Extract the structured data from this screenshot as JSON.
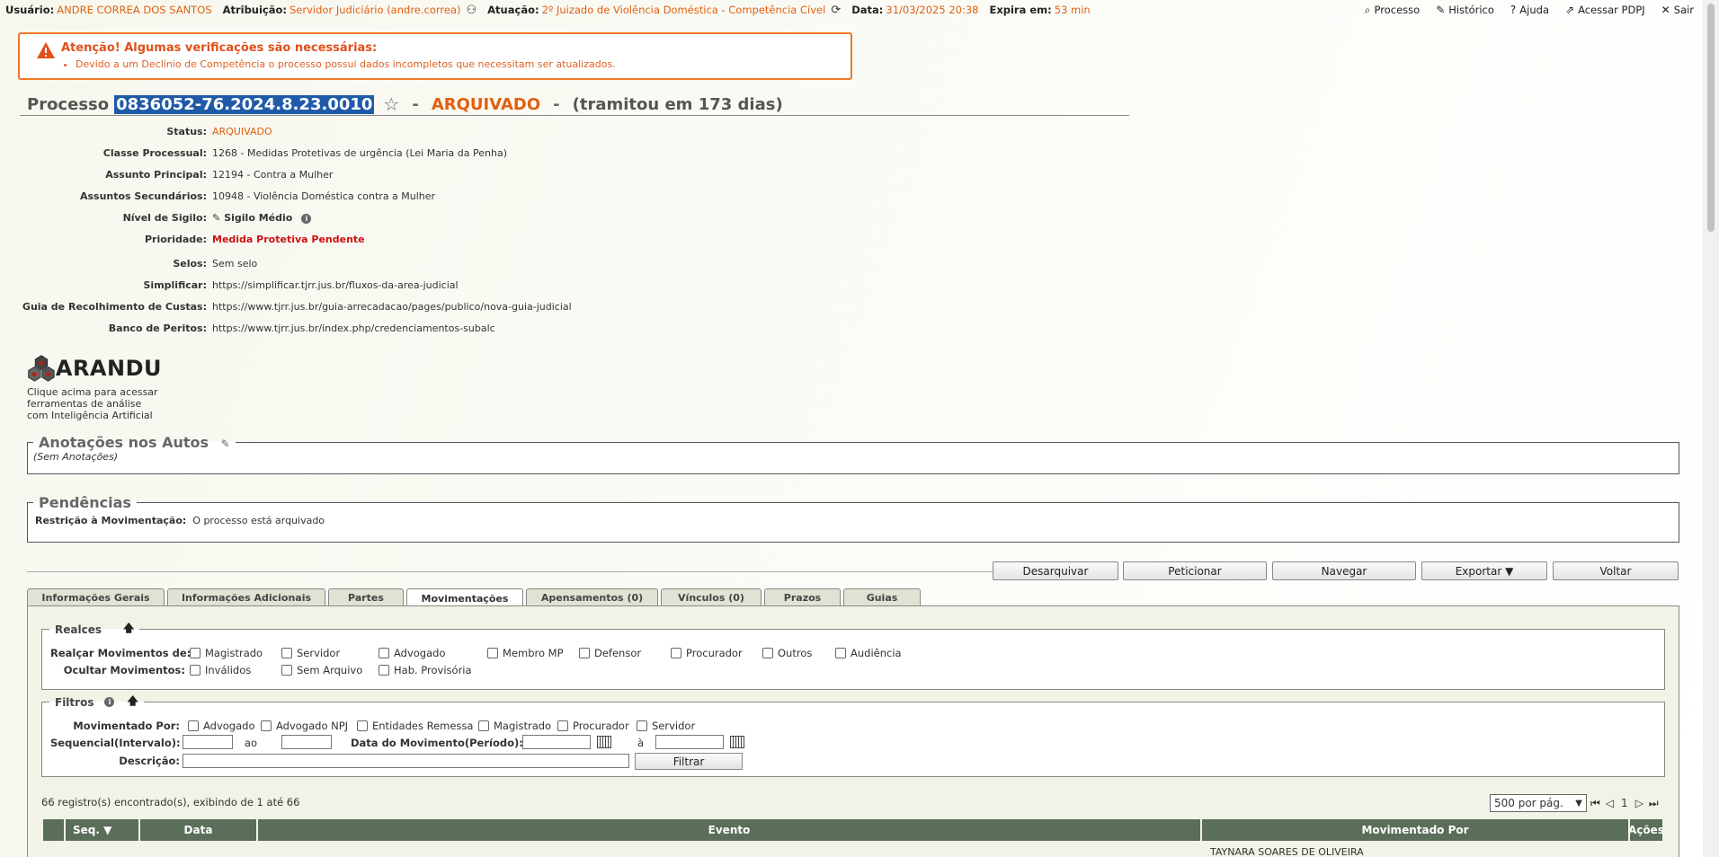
{
  "topbar": {
    "usuario_label": "Usuário:",
    "usuario": "ANDRE CORREA DOS SANTOS",
    "atribuicao_label": "Atribuição:",
    "atribuicao": "Servidor Judiciário (andre.correa)",
    "atuacao_label": "Atuação:",
    "atuacao": "2º Juizado de Violência Doméstica - Competência Cível",
    "data_label": "Data:",
    "data": "31/03/2025 20:38",
    "expira_label": "Expira em:",
    "expira": "53 min",
    "links": [
      "Processo",
      "Histórico",
      "Ajuda",
      "Acessar PDPJ",
      "Sair"
    ]
  },
  "alert": {
    "title": "Atenção! Algumas verificações são necessárias:",
    "item": "Devido a um Declínio de Competência o processo possui dados incompletos que necessitam ser atualizados."
  },
  "processo": {
    "label": "Processo",
    "numero": "0836052-76.2024.8.23.0010",
    "sep": "-",
    "status": "ARQUIVADO",
    "tramitou": "(tramitou em 173 dias)"
  },
  "fields": [
    {
      "label": "Status:",
      "value": "ARQUIVADO"
    },
    {
      "label": "Classe Processual:",
      "value": "1268 - Medidas Protetivas de urgência (Lei Maria da Penha)"
    },
    {
      "label": "Assunto Principal:",
      "value": "12194 - Contra a Mulher"
    },
    {
      "label": "Assuntos Secundários:",
      "value": "10948 - Violência Doméstica contra a Mulher"
    },
    {
      "label": "Nível de Sigilo:",
      "value": "Sigilo Médio"
    },
    {
      "label": "Prioridade:",
      "value": "Medida Protetiva Pendente"
    },
    {
      "label": "Selos:",
      "value": "Sem selo"
    },
    {
      "label": "Simplificar:",
      "value": "https://simplificar.tjrr.jus.br/fluxos-da-area-judicial"
    },
    {
      "label": "Guia de Recolhimento de Custas:",
      "value": "https://www.tjrr.jus.br/guia-arrecadacao/pages/publico/nova-guia-judicial"
    },
    {
      "label": "Banco de Peritos:",
      "value": "https://www.tjrr.jus.br/index.php/credenciamentos-subalc"
    }
  ],
  "arandu": {
    "name": "ARANDU",
    "line1": "Clique acima para acessar",
    "line2": "ferramentas de análise",
    "line3": "com Inteligência Artificial"
  },
  "anotacoes": {
    "title": "Anotações nos Autos",
    "empty": "(Sem Anotações)"
  },
  "pendencias": {
    "title": "Pendências",
    "label": "Restrição à Movimentação:",
    "value": "O processo está arquivado"
  },
  "actions": [
    "Desarquivar",
    "Peticionar",
    "Navegar",
    "Exportar ▼",
    "Voltar"
  ],
  "tabs": [
    "Informações Gerais",
    "Informações Adicionais",
    "Partes",
    "Movimentações",
    "Apensamentos (0)",
    "Vínculos (0)",
    "Prazos",
    "Guias"
  ],
  "realces": {
    "title": "Realces",
    "realcar_label": "Realçar Movimentos de:",
    "realcar": [
      "Magistrado",
      "Servidor",
      "Advogado",
      "Membro MP",
      "Defensor",
      "Procurador",
      "Outros",
      "Audiência"
    ],
    "ocultar_label": "Ocultar Movimentos:",
    "ocultar": [
      "Inválidos",
      "Sem Arquivo",
      "Hab. Provisória"
    ]
  },
  "filtros": {
    "title": "Filtros",
    "mov_por_label": "Movimentado Por:",
    "mov_por": [
      "Advogado",
      "Advogado NPJ",
      "Entidades Remessa",
      "Magistrado",
      "Procurador",
      "Servidor"
    ],
    "seq_label": "Sequencial(Intervalo):",
    "ao": "ao",
    "data_label": "Data do Movimento(Período):",
    "a": "à",
    "desc_label": "Descrição:",
    "filtrar": "Filtrar"
  },
  "table": {
    "count": "66 registro(s) encontrado(s), exibindo de 1 até 66",
    "per_page": "500 por pág.",
    "page": "1",
    "headers": [
      "Seq. ▼",
      "Data",
      "Evento",
      "Movimentado Por",
      "Ações"
    ],
    "first_row_mov": "TAYNARA SOARES DE OLIVEIRA"
  }
}
